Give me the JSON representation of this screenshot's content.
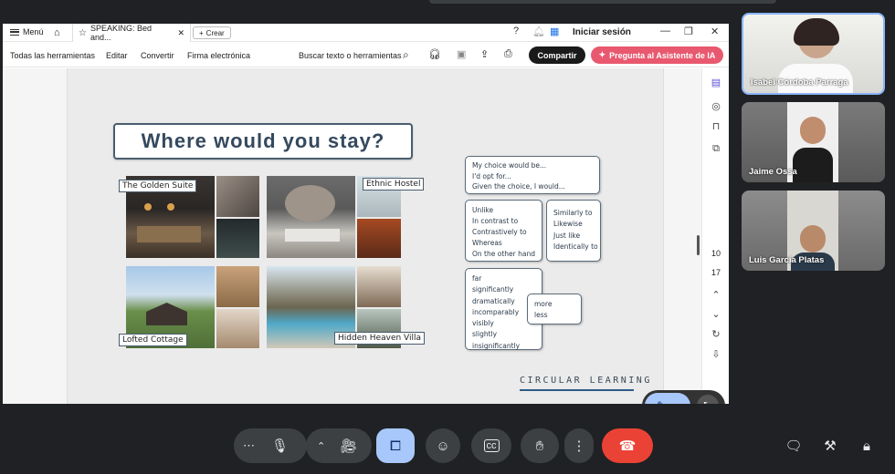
{
  "browser": {
    "menu_label": "Menú",
    "tab_title": "SPEAKING: Bed and...",
    "new_tab_label": "Crear",
    "login_label": "Iniciar sesión"
  },
  "toolbar": {
    "all_tools": "Todas las herramientas",
    "edit": "Editar",
    "convert": "Convertir",
    "sign": "Firma electrónica",
    "search_placeholder": "Buscar texto o herramientas",
    "share": "Compartir",
    "ai_assistant": "Pregunta al Asistente de IA"
  },
  "pager": {
    "current": "10",
    "total": "17"
  },
  "slide": {
    "title": "Where would you stay?",
    "places": [
      "The Golden Suite",
      "Ethnic Hostel",
      "Lofted Cottage",
      "Hidden Heaven Villa"
    ],
    "phrases_choice": [
      "My choice would be...",
      "I'd opt for...",
      "Given the choice, I would..."
    ],
    "phrases_contrast": [
      "Unlike",
      "In contrast to",
      "Contrastively to",
      "Whereas",
      "On the other hand"
    ],
    "phrases_similar": [
      "Similarly to",
      "Likewise",
      "Just like",
      "Identically to"
    ],
    "phrases_degree": [
      "far",
      "significantly",
      "dramatically",
      "incomparably",
      "visibly",
      "slightly",
      "insignificantly"
    ],
    "phrases_compare": [
      "more",
      "less"
    ],
    "brand": "CIRCULAR LEARNING"
  },
  "participants": [
    {
      "name": "Isabel Córdoba Parraga"
    },
    {
      "name": "Jaime Ossa"
    },
    {
      "name": "Luis García Platas"
    }
  ],
  "icons": [
    "menu-icon",
    "home-icon",
    "star-icon",
    "close-icon",
    "plus-icon",
    "help-icon",
    "bell-icon",
    "apps-icon",
    "search-icon",
    "headphones-icon",
    "save-icon",
    "upload-icon",
    "print-icon",
    "sparkle-icon",
    "mic-icon",
    "camera-icon",
    "present-icon",
    "emoji-icon",
    "captions-icon",
    "hand-icon",
    "more-icon",
    "end-call-icon",
    "chat-icon",
    "tools-icon",
    "lock-person-icon"
  ],
  "colors": {
    "share": "#1a1a1a",
    "ai": "#e8596f",
    "present": "#a8c7fa",
    "end_call": "#ea4335"
  }
}
